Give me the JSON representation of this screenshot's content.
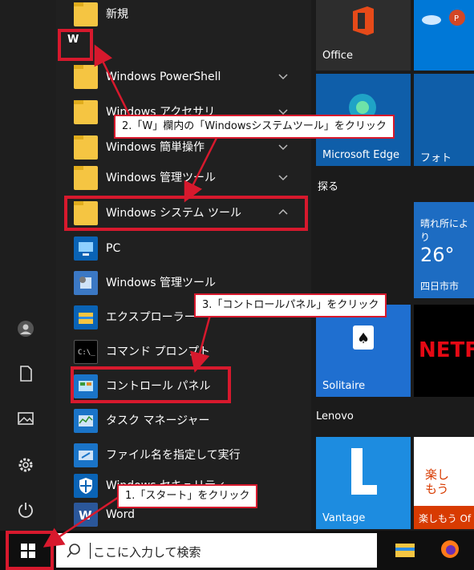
{
  "start_menu": {
    "letter_header": "W",
    "top_item": {
      "label": "新規",
      "icon": "folder-icon"
    },
    "items": [
      {
        "label": "Windows PowerShell",
        "icon": "folder-icon",
        "has_chevron": true
      },
      {
        "label": "Windows アクセサリ",
        "icon": "folder-icon",
        "has_chevron": true
      },
      {
        "label": "Windows 簡単操作",
        "icon": "folder-icon",
        "has_chevron": true
      },
      {
        "label": "Windows 管理ツール",
        "icon": "folder-icon",
        "has_chevron": true
      },
      {
        "label": "Windows システム ツール",
        "icon": "folder-icon",
        "has_chevron": true,
        "expanded": true
      },
      {
        "label": "PC",
        "icon": "pc-icon"
      },
      {
        "label": "Windows 管理ツール",
        "icon": "admin-tools-icon"
      },
      {
        "label": "エクスプローラー",
        "icon": "explorer-icon"
      },
      {
        "label": "コマンド プロンプト",
        "icon": "cmd-icon"
      },
      {
        "label": "コントロール パネル",
        "icon": "control-panel-icon"
      },
      {
        "label": "タスク マネージャー",
        "icon": "task-manager-icon"
      },
      {
        "label": "ファイル名を指定して実行",
        "icon": "run-icon"
      },
      {
        "label": "Windows セキュリティ",
        "icon": "shield-icon"
      },
      {
        "label": "Word",
        "icon": "word-icon"
      }
    ]
  },
  "tiles": {
    "office_label": "Office",
    "edge_label": "Microsoft Edge",
    "photos_label": "フォト",
    "group_explore": "探る",
    "weather_desc": "晴れ所により",
    "weather_temp": "26°",
    "weather_city": "四日市市",
    "solitaire_label": "Solitaire",
    "group_lenovo": "Lenovo",
    "vantage_label": "Vantage",
    "rakushimou_label": "楽しもう Of",
    "rakushimou_big": "楽し\nもう",
    "netflix_label": "NETFL"
  },
  "taskbar": {
    "search_placeholder": "ここに入力して検索"
  },
  "annotations": {
    "step1": "1.「スタート」をクリック",
    "step2": "2.「W」欄内の「Windowsシステムツール」をクリック",
    "step3": "3.「コントロールパネル」をクリック"
  },
  "colors": {
    "accent_red": "#d7192d",
    "tile_blue": "#0078d7",
    "folder_yellow": "#f5c542"
  }
}
